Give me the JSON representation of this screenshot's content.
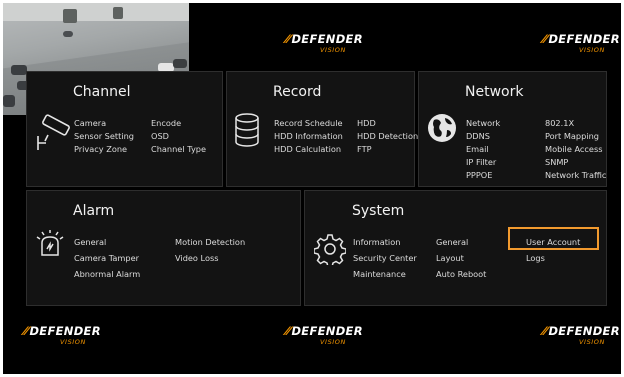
{
  "logo": {
    "brand": "DEFENDER",
    "sub": "VISION"
  },
  "channel": {
    "title": "Channel",
    "items": [
      "Camera",
      "Sensor Setting",
      "Privacy Zone",
      "Encode",
      "OSD",
      "Channel Type"
    ]
  },
  "record": {
    "title": "Record",
    "items": [
      "Record Schedule",
      "HDD Information",
      "HDD Calculation",
      "HDD",
      "HDD Detection",
      "FTP"
    ]
  },
  "network": {
    "title": "Network",
    "items": [
      "Network",
      "DDNS",
      "Email",
      "IP Filter",
      "PPPOE",
      "802.1X",
      "Port Mapping",
      "Mobile Access",
      "SNMP",
      "Network Traffic"
    ]
  },
  "alarm": {
    "title": "Alarm",
    "items": [
      "General",
      "Camera Tamper",
      "Abnormal Alarm",
      "Motion Detection",
      "Video Loss"
    ]
  },
  "system": {
    "title": "System",
    "items": [
      "Information",
      "Security Center",
      "Maintenance",
      "General",
      "Layout",
      "Auto Reboot",
      "User Account",
      "Logs"
    ]
  },
  "colors": {
    "accent": "#f29400",
    "highlight": "#f29a2e",
    "panel": "#131313",
    "background": "#000000"
  }
}
